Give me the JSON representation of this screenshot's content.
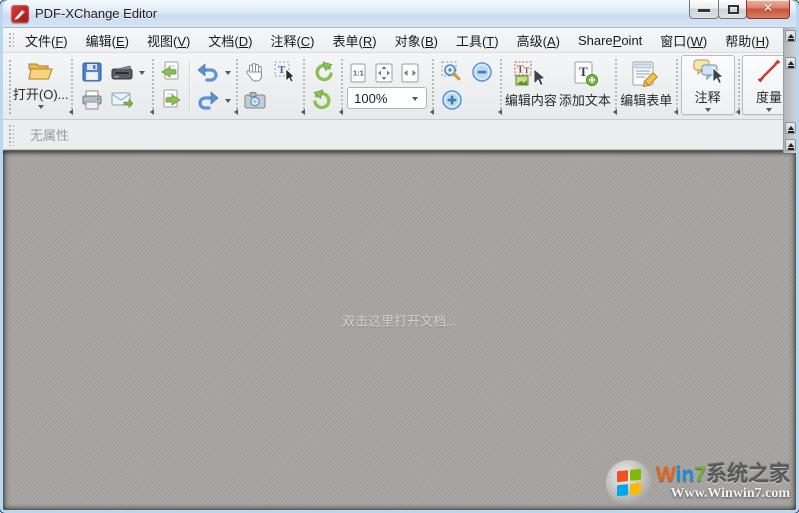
{
  "window": {
    "title": "PDF-XChange Editor"
  },
  "menu": {
    "items": [
      {
        "prefix": "文件(",
        "key": "F",
        "suffix": ")"
      },
      {
        "prefix": "编辑(",
        "key": "E",
        "suffix": ")"
      },
      {
        "prefix": "视图(",
        "key": "V",
        "suffix": ")"
      },
      {
        "prefix": "文档(",
        "key": "D",
        "suffix": ")"
      },
      {
        "prefix": "注释(",
        "key": "C",
        "suffix": ")"
      },
      {
        "prefix": "表单(",
        "key": "R",
        "suffix": ")"
      },
      {
        "prefix": "对象(",
        "key": "B",
        "suffix": ")"
      },
      {
        "prefix": "工具(",
        "key": "T",
        "suffix": ")"
      },
      {
        "prefix": "高级(",
        "key": "A",
        "suffix": ")"
      },
      {
        "prefix": "Share",
        "key": "P",
        "suffix": "oint"
      },
      {
        "prefix": "窗口(",
        "key": "W",
        "suffix": ")"
      },
      {
        "prefix": "帮助(",
        "key": "H",
        "suffix": ")"
      }
    ]
  },
  "toolbar": {
    "open_label": "打开(O)...",
    "zoom_value": "100%",
    "actual_size_label": "1:1",
    "edit_content_label": "编辑内容",
    "add_text_label": "添加文本",
    "edit_form_label": "编辑表单",
    "comment_label": "注释",
    "measure_label": "度量",
    "icons": [
      "folder-open-icon",
      "save-icon",
      "scanner-icon",
      "printer-icon",
      "email-icon",
      "prev-view-icon",
      "next-view-icon",
      "undo-icon",
      "redo-icon",
      "hand-icon",
      "select-text-icon",
      "snapshot-icon",
      "rotate-ccw-icon",
      "rotate-cw-icon",
      "actual-size-icon",
      "fit-page-icon",
      "fit-width-icon",
      "zoom-marquee-icon",
      "zoom-out-icon",
      "zoom-in-icon",
      "edit-content-icon",
      "add-text-icon",
      "edit-form-icon",
      "comment-icon",
      "measure-icon"
    ]
  },
  "properties_bar": {
    "label": "无属性"
  },
  "canvas": {
    "hint": "双击这里打开文档..."
  },
  "watermark": {
    "brand_w": "W",
    "brand_i": "i",
    "brand_n": "n",
    "brand_7": "7",
    "brand_site": "系统之家",
    "url": "Www.Winwin7.com"
  },
  "colors": {
    "titlebar_top": "#f4f9fd",
    "titlebar_bottom": "#d7e5f4",
    "frame_blue": "#b9d8ef",
    "close_red": "#c4543e",
    "canvas_gray": "#a7a5a2",
    "accent_blue": "#4a86c8",
    "rotate_green": "#7ab648",
    "measure_red": "#d03a2b"
  }
}
